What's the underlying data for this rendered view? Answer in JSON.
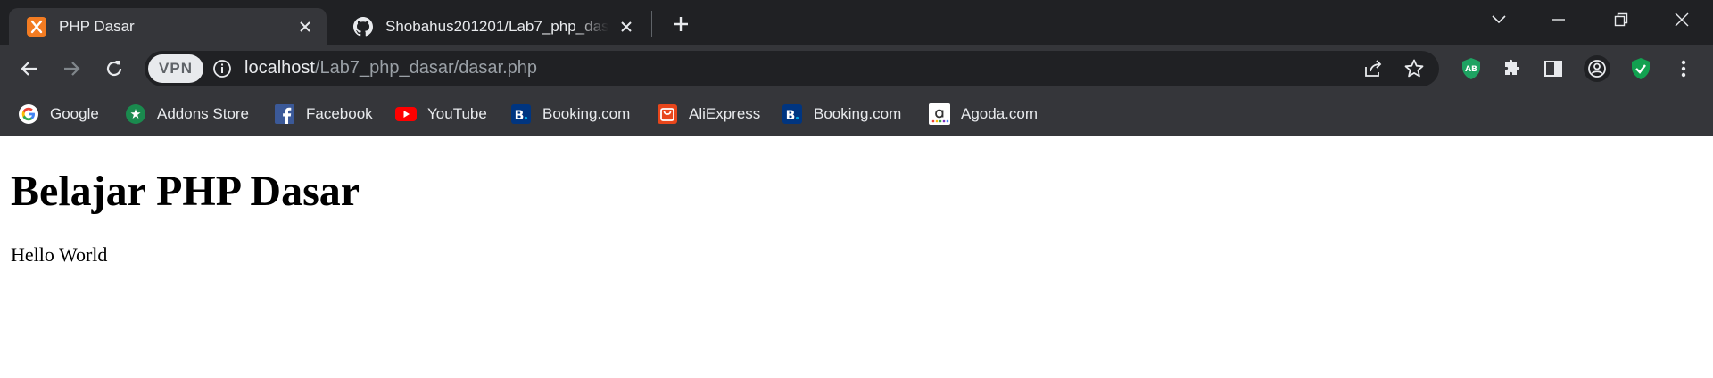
{
  "browser": {
    "tabs": [
      {
        "title": "PHP Dasar",
        "icon": "xampp-icon",
        "active": true
      },
      {
        "title": "Shobahus201201/Lab7_php_dasar",
        "icon": "github-icon",
        "active": false
      }
    ],
    "address_bar": {
      "vpn_label": "VPN",
      "url_host": "localhost",
      "url_path": "/Lab7_php_dasar/dasar.php"
    },
    "extensions": [
      "adblock-icon",
      "puzzle-icon",
      "side-panel-icon",
      "profile-icon",
      "shield-check-icon",
      "more-menu-icon"
    ],
    "bookmarks": [
      {
        "label": "Google",
        "icon": "google-icon"
      },
      {
        "label": "Addons Store",
        "icon": "addons-store-icon"
      },
      {
        "label": "Facebook",
        "icon": "facebook-icon"
      },
      {
        "label": "YouTube",
        "icon": "youtube-icon"
      },
      {
        "label": "Booking.com",
        "icon": "booking-icon"
      },
      {
        "label": "AliExpress",
        "icon": "aliexpress-icon"
      },
      {
        "label": "Booking.com",
        "icon": "booking-icon"
      },
      {
        "label": "Agoda.com",
        "icon": "agoda-icon"
      }
    ],
    "colors": {
      "tabstrip_bg": "#202124",
      "toolbar_bg": "#35363a",
      "text": "#e8eaed",
      "url_dim": "#9aa0a6"
    }
  },
  "page": {
    "heading": "Belajar PHP Dasar",
    "paragraph": "Hello World"
  }
}
